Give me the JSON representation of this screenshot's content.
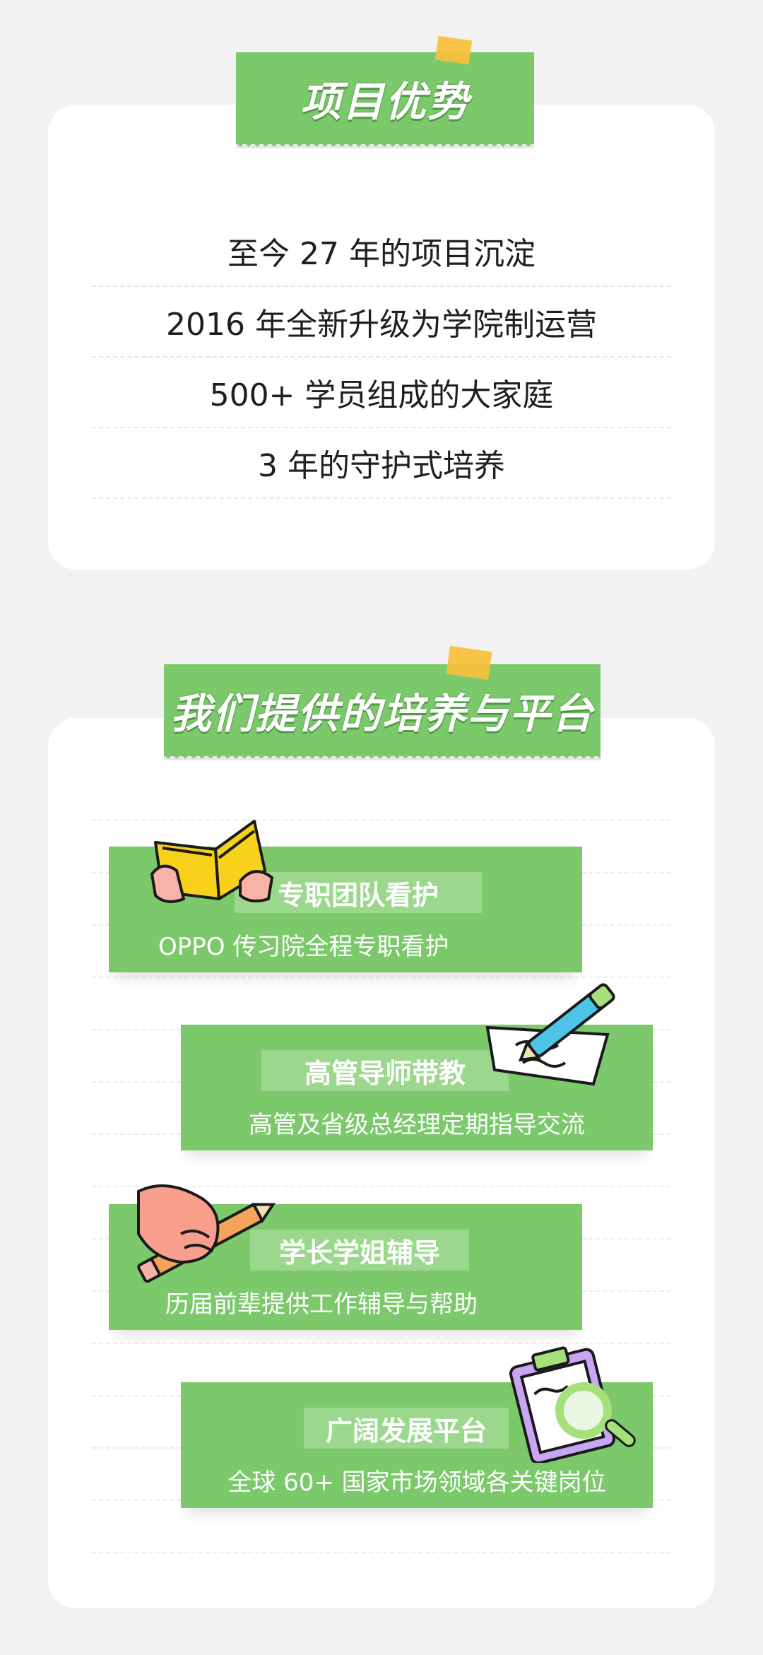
{
  "section1": {
    "title": "项目优势",
    "items": [
      "至今 27 年的项目沉淀",
      "2016 年全新升级为学院制运营",
      "500+ 学员组成的大家庭",
      "3 年的守护式培养"
    ]
  },
  "section2": {
    "title": "我们提供的培养与平台",
    "features": [
      {
        "title": "专职团队看护",
        "desc": "OPPO 传习院全程专职看护",
        "icon": "book-icon"
      },
      {
        "title": "高管导师带教",
        "desc": "高管及省级总经理定期指导交流",
        "icon": "pen-paper-icon"
      },
      {
        "title": "学长学姐辅导",
        "desc": "历届前辈提供工作辅导与帮助",
        "icon": "hand-pencil-icon"
      },
      {
        "title": "广阔发展平台",
        "desc": "全球 60+ 国家市场领域各关键岗位",
        "icon": "clipboard-magnifier-icon"
      }
    ]
  },
  "colors": {
    "page_bg": "#f2f2f2",
    "card_bg": "#ffffff",
    "banner_green": "#7cc96c",
    "title_green": "#9bd88d",
    "tape_yellow": "#f7c13d",
    "text_dark": "#1f1f1f"
  }
}
